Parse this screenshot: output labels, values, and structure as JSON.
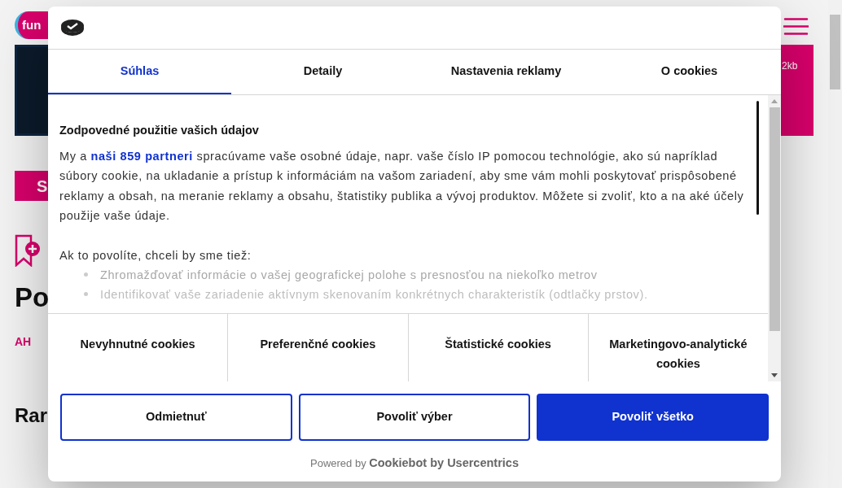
{
  "background_page": {
    "logo": "fun",
    "hero_badge": "2kb",
    "button_label": "S",
    "heading": "Po",
    "tag": "AH",
    "subheading": "Rar"
  },
  "dialog": {
    "tabs": [
      {
        "label": "Súhlas",
        "selected": true
      },
      {
        "label": "Detaily",
        "selected": false
      },
      {
        "label": "Nastavenia reklamy",
        "selected": false
      },
      {
        "label": "O cookies",
        "selected": false
      }
    ],
    "content": {
      "title": "Zodpovedné použitie vašich údajov",
      "intro_start": "My a",
      "partners_link": "naši 859 partneri",
      "intro_rest": "spracúvame vaše osobné údaje, napr. vaše číslo IP pomocou technológie, ako sú napríklad súbory cookie, na ukladanie a prístup k informáciám na vašom zariadení, aby sme vám mohli poskytovať prispôsobené reklamy a obsah, na meranie reklamy a obsahu, štatistiky publika a vývoj produktov. Môžete si zvoliť, kto a na aké účely použije vaše údaje.",
      "list_intro": "Ak to povolíte, chceli by sme tiež:",
      "bullets": [
        "Zhromažďovať informácie o vašej geografickej polohe s presnosťou na niekoľko metrov",
        "Identifikovať vaše zariadenie aktívnym skenovaním konkrétnych charakteristík (odtlačky prstov)."
      ]
    },
    "categories": [
      "Nevyhnutné cookies",
      "Preferenčné cookies",
      "Štatistické cookies",
      "Marketingovo-analytické cookies"
    ],
    "buttons": [
      {
        "label": "Odmietnuť",
        "kind": "outline"
      },
      {
        "label": "Povoliť výber",
        "kind": "outline"
      },
      {
        "label": "Povoliť všetko",
        "kind": "primary"
      }
    ],
    "footer": {
      "prefix": "Powered by",
      "brand": "Cookiebot by Usercentrics"
    }
  }
}
